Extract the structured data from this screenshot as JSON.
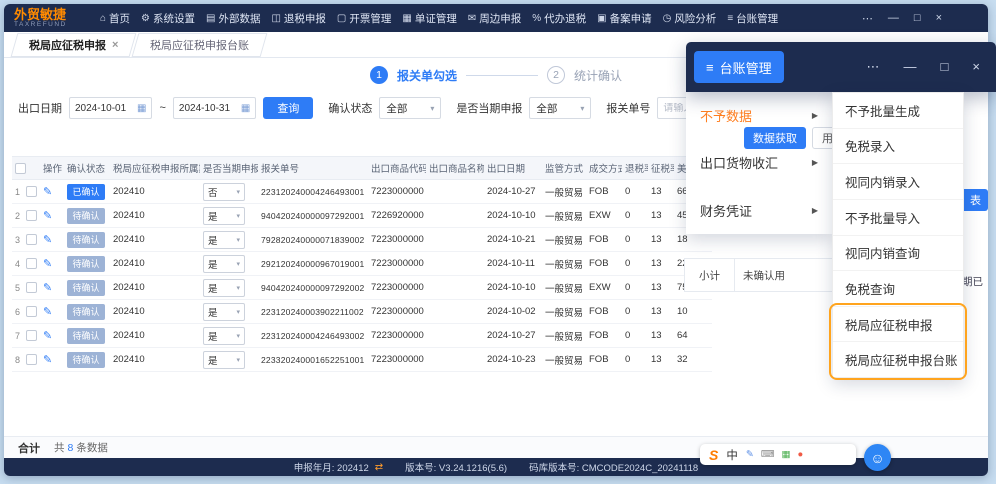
{
  "window": {
    "logo_title": "外贸敏捷",
    "logo_subtitle": "TAXREFUND",
    "nav_items": [
      {
        "icon": "⌂",
        "name": "home",
        "label": "首页"
      },
      {
        "icon": "⚙",
        "name": "system-settings",
        "label": "系统设置"
      },
      {
        "icon": "▤",
        "name": "external-data",
        "label": "外部数据"
      },
      {
        "icon": "◫",
        "name": "refund-declare",
        "label": "退税申报"
      },
      {
        "icon": "▢",
        "name": "invoice-mgmt",
        "label": "开票管理"
      },
      {
        "icon": "▦",
        "name": "document-mgmt",
        "label": "单证管理"
      },
      {
        "icon": "✉",
        "name": "peripheral-declare",
        "label": "周边申报"
      },
      {
        "icon": "%",
        "name": "agent-refund",
        "label": "代办退税"
      },
      {
        "icon": "▣",
        "name": "filing-apply",
        "label": "备案申请"
      },
      {
        "icon": "◷",
        "name": "risk-analysis",
        "label": "风险分析"
      },
      {
        "icon": "≡",
        "name": "ledger-mgmt",
        "label": "台账管理"
      }
    ],
    "controls": {
      "more": "⋯",
      "minimize": "—",
      "maximize": "□",
      "close": "×"
    }
  },
  "tabs": {
    "tab1": "税局应征税申报",
    "tab1_close": "×",
    "tab2": "税局应征税申报台账"
  },
  "stepper": {
    "step1_num": "1",
    "step1_label": "报关单勾选",
    "step2_num": "2",
    "step2_label": "统计确认"
  },
  "filters": {
    "date_label": "出口日期",
    "date_from": "2024-10-01",
    "date_to": "2024-10-31",
    "range_sep": "~",
    "search_btn": "查询",
    "confirm_label": "确认状态",
    "confirm_value": "全部",
    "period_label": "是否当期申报",
    "period_value": "全部",
    "decl_label": "报关单号",
    "decl_placeholder": "请输入报关单号"
  },
  "actions": {
    "fetch": "数据获取",
    "identify": "用途识别"
  },
  "table": {
    "headers": [
      "",
      "操作",
      "确认状态",
      "税局应征税申报所属期",
      "是否当期申报",
      "报关单号",
      "出口商品代码",
      "出口商品名称",
      "出口日期",
      "监管方式",
      "成交方式",
      "退税率",
      "征税率",
      "美元离岸价"
    ],
    "rows": [
      {
        "num": "1",
        "status": "已确认",
        "confirmed": true,
        "period": "202410",
        "current": "否",
        "decl_no": "223120240004246493001",
        "product_code": "7223000000",
        "product_name": "",
        "export_date": "2024-10-27",
        "trade_mode": "一般贸易",
        "terms": "FOB",
        "refund_rate": "0",
        "tax_rate": "13",
        "usd_fob": "66"
      },
      {
        "num": "2",
        "status": "待确认",
        "confirmed": false,
        "period": "202410",
        "current": "是",
        "decl_no": "940420240000097292001",
        "product_code": "7226920000",
        "product_name": "",
        "export_date": "2024-10-10",
        "trade_mode": "一般贸易",
        "terms": "EXW",
        "refund_rate": "0",
        "tax_rate": "13",
        "usd_fob": "45"
      },
      {
        "num": "3",
        "status": "待确认",
        "confirmed": false,
        "period": "202410",
        "current": "是",
        "decl_no": "792820240000071839002",
        "product_code": "7223000000",
        "product_name": "",
        "export_date": "2024-10-21",
        "trade_mode": "一般贸易",
        "terms": "FOB",
        "refund_rate": "0",
        "tax_rate": "13",
        "usd_fob": "18"
      },
      {
        "num": "4",
        "status": "待确认",
        "confirmed": false,
        "period": "202410",
        "current": "是",
        "decl_no": "292120240000967019001",
        "product_code": "7223000000",
        "product_name": "",
        "export_date": "2024-10-11",
        "trade_mode": "一般贸易",
        "terms": "FOB",
        "refund_rate": "0",
        "tax_rate": "13",
        "usd_fob": "22"
      },
      {
        "num": "5",
        "status": "待确认",
        "confirmed": false,
        "period": "202410",
        "current": "是",
        "decl_no": "940420240000097292002",
        "product_code": "7223000000",
        "product_name": "",
        "export_date": "2024-10-10",
        "trade_mode": "一般贸易",
        "terms": "EXW",
        "refund_rate": "0",
        "tax_rate": "13",
        "usd_fob": "75"
      },
      {
        "num": "6",
        "status": "待确认",
        "confirmed": false,
        "period": "202410",
        "current": "是",
        "decl_no": "223120240003902211002",
        "product_code": "7223000000",
        "product_name": "",
        "export_date": "2024-10-02",
        "trade_mode": "一般贸易",
        "terms": "FOB",
        "refund_rate": "0",
        "tax_rate": "13",
        "usd_fob": "10"
      },
      {
        "num": "7",
        "status": "待确认",
        "confirmed": false,
        "period": "202410",
        "current": "是",
        "decl_no": "223120240004246493002",
        "product_code": "7223000000",
        "product_name": "",
        "export_date": "2024-10-27",
        "trade_mode": "一般贸易",
        "terms": "FOB",
        "refund_rate": "0",
        "tax_rate": "13",
        "usd_fob": "64"
      },
      {
        "num": "8",
        "status": "待确认",
        "confirmed": false,
        "period": "202410",
        "current": "是",
        "decl_no": "223320240001652251001",
        "product_code": "7223000000",
        "product_name": "",
        "export_date": "2024-10-23",
        "trade_mode": "一般贸易",
        "terms": "FOB",
        "refund_rate": "0",
        "tax_rate": "13",
        "usd_fob": "32"
      }
    ]
  },
  "fragments": {
    "subtotal": "小计",
    "unconfirmed": "未确认用",
    "right_text": "期已",
    "right_button": "表"
  },
  "footer": {
    "total_label": "合计",
    "count_pre": "共",
    "count_num": "8",
    "count_post": "条数据"
  },
  "statusbar": {
    "period": "申报年月: 202412",
    "swap_icon": "⇄",
    "version": "版本号: V3.24.1216(5.6)",
    "code_version": "码库版本号: CMCODE2024C_20241118"
  },
  "popup": {
    "title_button": "台账管理",
    "title_icon": "≡",
    "controls": {
      "more": "⋯",
      "minimize": "—",
      "maximize": "□",
      "close": "×"
    },
    "menu_items": [
      {
        "label": "不予数据",
        "arrow": "▶",
        "hot": true
      },
      {
        "label": "出口货物收汇",
        "arrow": "▶",
        "hot": false
      },
      {
        "label": "财务凭证",
        "arrow": "▶",
        "hot": false
      }
    ],
    "submenu_items": [
      "不予批量生成",
      "免税录入",
      "视同内销录入",
      "不予批量导入",
      "视同内销查询",
      "免税查询",
      "税局应征税申报",
      "税局应征税申报台账"
    ],
    "highlight_start_index": 6
  },
  "ime": {
    "logo": "S",
    "lang": "中",
    "icons": [
      {
        "glyph": "✎",
        "color": "#5b8ee6",
        "name": "pen-icon"
      },
      {
        "glyph": "⌨",
        "color": "#888888",
        "name": "keyboard-icon"
      },
      {
        "glyph": "▦",
        "color": "#4aae4f",
        "name": "toolbox-icon"
      },
      {
        "glyph": "●",
        "color": "#f05a45",
        "name": "record-icon"
      }
    ]
  },
  "assistant_icon": "☺",
  "colors": {
    "accent": "#2e7cf6",
    "topbar": "#1d2c4f",
    "brand_orange": "#ff8a00",
    "highlight_border": "#ffa41e",
    "pending_badge": "#9db3d6"
  }
}
